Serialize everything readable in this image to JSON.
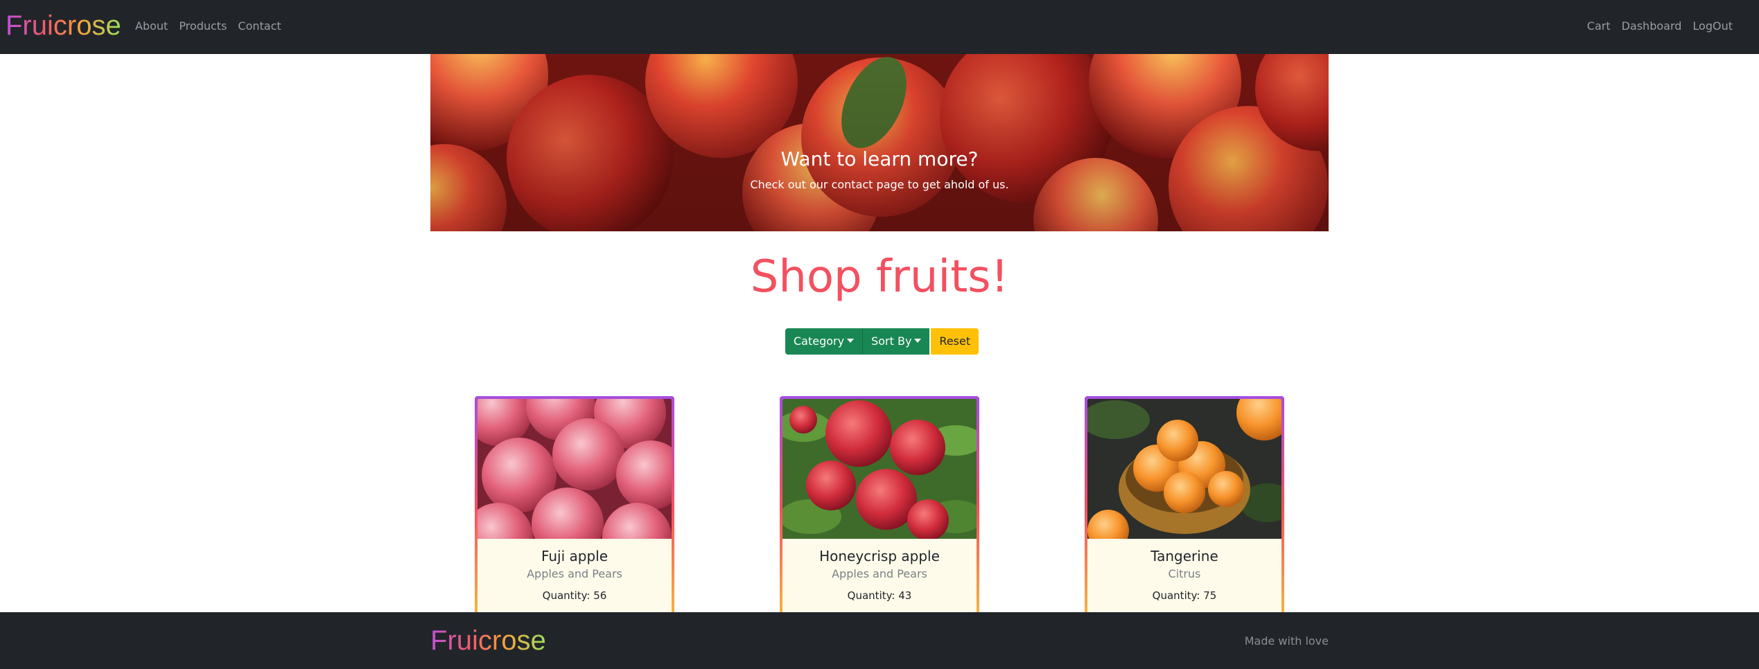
{
  "navbar": {
    "brand": "Fruicrose",
    "left_links": [
      "About",
      "Products",
      "Contact"
    ],
    "right_links": [
      "Cart",
      "Dashboard",
      "LogOut"
    ]
  },
  "hero": {
    "title": "Want to learn more?",
    "subtitle": "Check out our contact page to get ahold of us."
  },
  "shop": {
    "title": "Shop fruits!",
    "filters": {
      "category_label": "Category",
      "sort_label": "Sort By",
      "reset_label": "Reset"
    }
  },
  "products": [
    {
      "name": "Fuji apple",
      "category": "Apples and Pears",
      "quantity": "Quantity: 56"
    },
    {
      "name": "Honeycrisp apple",
      "category": "Apples and Pears",
      "quantity": "Quantity: 43"
    },
    {
      "name": "Tangerine",
      "category": "Citrus",
      "quantity": "Quantity: 75"
    }
  ],
  "footer": {
    "brand": "Fruicrose",
    "tagline": "Made with love"
  },
  "colors": {
    "navbar_bg": "#212529",
    "heading": "#f45060",
    "btn_green": "#198754",
    "btn_yellow": "#ffc107",
    "card_bg": "#fffbeb"
  }
}
